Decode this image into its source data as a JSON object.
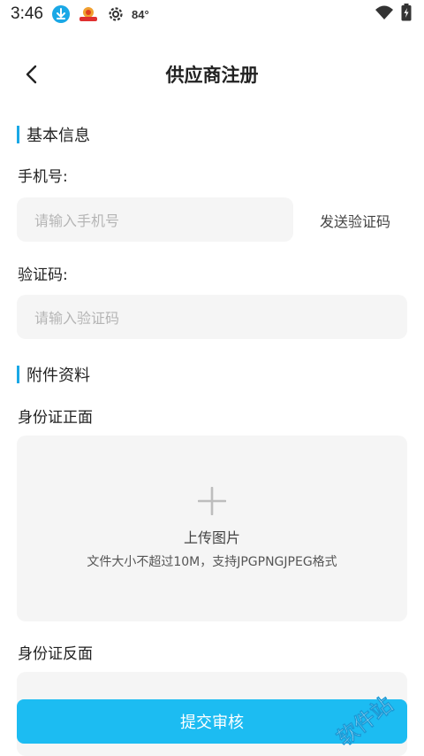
{
  "statusbar": {
    "time": "3:46",
    "temperature": "84°",
    "icons": [
      "download-icon",
      "app-badge-icon",
      "gear-icon",
      "wifi-icon",
      "battery-charging-icon"
    ]
  },
  "nav": {
    "title": "供应商注册",
    "back_icon": "chevron-left-icon"
  },
  "sections": {
    "basic": {
      "title": "基本信息"
    },
    "attachments": {
      "title": "附件资料"
    }
  },
  "form": {
    "phone": {
      "label": "手机号:",
      "placeholder": "请输入手机号",
      "value": ""
    },
    "send_code_label": "发送验证码",
    "code": {
      "label": "验证码:",
      "placeholder": "请输入验证码",
      "value": ""
    }
  },
  "uploads": {
    "front": {
      "label": "身份证正面",
      "title": "上传图片",
      "hint": "文件大小不超过10M，支持JPGPNGJPEG格式"
    },
    "back": {
      "label": "身份证反面"
    }
  },
  "submit_label": "提交审核",
  "watermark_text": "软件站",
  "colors": {
    "accent": "#1aa8e6",
    "button": "#1cbcf2",
    "input_bg": "#f5f5f5",
    "placeholder": "#b5b5b5"
  }
}
